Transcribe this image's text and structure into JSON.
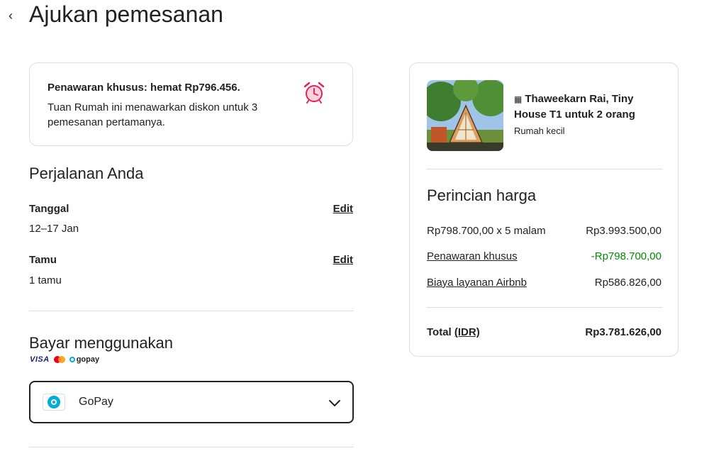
{
  "header": {
    "back_icon": "chevron-left-icon",
    "title": "Ajukan pemesanan"
  },
  "offer": {
    "title": "Penawaran khusus: hemat Rp796.456.",
    "description": "Tuan Rumah ini menawarkan diskon untuk 3 pemesanan pertamanya.",
    "icon": "alarm-clock-icon",
    "icon_color": "#e0245e"
  },
  "trip": {
    "title": "Perjalanan Anda",
    "dates_label": "Tanggal",
    "dates_value": "12–17 Jan",
    "guests_label": "Tamu",
    "guests_value": "1 tamu",
    "edit_label": "Edit"
  },
  "payment": {
    "title": "Bayar menggunakan",
    "logos": {
      "visa": "VISA",
      "gopay": "gopay"
    },
    "selected_method": "GoPay",
    "method_icon": "gopay-icon",
    "chevron_icon": "chevron-down-icon"
  },
  "listing": {
    "building_icon": "building-icon",
    "name": "Thaweekarn Rai, Tiny House T1 untuk 2 orang",
    "type": "Rumah kecil"
  },
  "price": {
    "title": "Perincian harga",
    "rows": [
      {
        "label": "Rp798.700,00 x 5 malam",
        "value": "Rp3.993.500,00"
      },
      {
        "label": "Penawaran khusus",
        "value": "-Rp798.700,00"
      },
      {
        "label": "Biaya layanan Airbnb",
        "value": "Rp586.826,00"
      }
    ],
    "total_label": "Total",
    "total_currency": "(IDR)",
    "total_value": "Rp3.781.626,00"
  },
  "colors": {
    "discount": "#008a05",
    "text": "#222222",
    "border": "#dddddd"
  }
}
